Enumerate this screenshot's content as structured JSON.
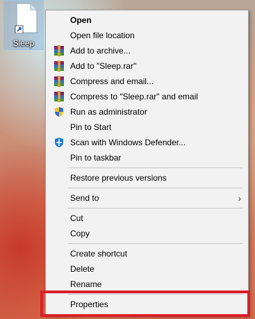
{
  "desktop": {
    "icon_label": "Sleep",
    "icon_name": "shortcut-file-icon"
  },
  "menu": {
    "items": [
      {
        "label": "Open",
        "bold": true,
        "icon": ""
      },
      {
        "label": "Open file location",
        "icon": ""
      },
      {
        "label": "Add to archive...",
        "icon": "winrar-icon"
      },
      {
        "label": "Add to \"Sleep.rar\"",
        "icon": "winrar-icon"
      },
      {
        "label": "Compress and email...",
        "icon": "winrar-icon"
      },
      {
        "label": "Compress to \"Sleep.rar\" and email",
        "icon": "winrar-icon"
      },
      {
        "label": "Run as administrator",
        "icon": "uac-shield-icon"
      },
      {
        "label": "Pin to Start",
        "icon": ""
      },
      {
        "label": "Scan with Windows Defender...",
        "icon": "windows-defender-icon"
      },
      {
        "label": "Pin to taskbar",
        "icon": ""
      },
      {
        "label": "Restore previous versions",
        "icon": ""
      },
      {
        "label": "Send to",
        "icon": "",
        "submenu": true
      },
      {
        "label": "Cut",
        "icon": ""
      },
      {
        "label": "Copy",
        "icon": ""
      },
      {
        "label": "Create shortcut",
        "icon": ""
      },
      {
        "label": "Delete",
        "icon": ""
      },
      {
        "label": "Rename",
        "icon": ""
      },
      {
        "label": "Properties",
        "icon": "",
        "highlighted": true
      }
    ],
    "submenu_arrow": "›"
  },
  "colors": {
    "highlight_border": "#d8202a",
    "menu_bg": "#f2f2f2"
  }
}
